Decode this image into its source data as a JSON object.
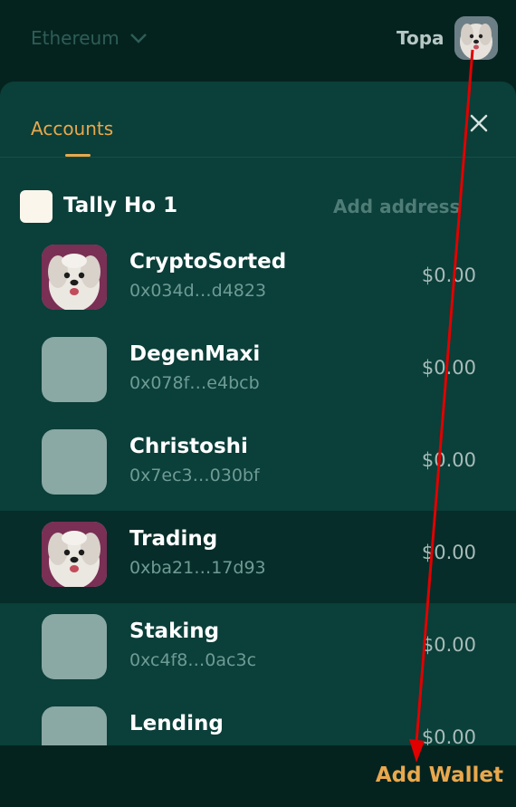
{
  "topbar": {
    "network_label": "Ethereum",
    "account_name": "Topa"
  },
  "tabs": {
    "accounts_label": "Accounts"
  },
  "group": {
    "name": "Tally Ho 1",
    "add_address_label": "Add address"
  },
  "accounts": [
    {
      "name": "CryptoSorted",
      "address": "0x034d…d4823",
      "balance": "$0.00",
      "avatar": "dog-avatar"
    },
    {
      "name": "DegenMaxi",
      "address": "0x078f…e4bcb",
      "balance": "$0.00",
      "avatar": "placeholder"
    },
    {
      "name": "Christoshi",
      "address": "0x7ec3…030bf",
      "balance": "$0.00",
      "avatar": "placeholder"
    },
    {
      "name": "Trading",
      "address": "0xba21…17d93",
      "balance": "$0.00",
      "avatar": "dog-avatar",
      "selected": true
    },
    {
      "name": "Staking",
      "address": "0xc4f8…0ac3c",
      "balance": "$0.00",
      "avatar": "placeholder"
    },
    {
      "name": "Lending",
      "address": "",
      "balance": "$0.00",
      "avatar": "placeholder"
    }
  ],
  "footer": {
    "add_wallet_label": "Add Wallet"
  },
  "colors": {
    "accent": "#e9a84d",
    "background": "#04231f",
    "panel": "#0b3f39",
    "annotation_arrow": "#e00000"
  }
}
